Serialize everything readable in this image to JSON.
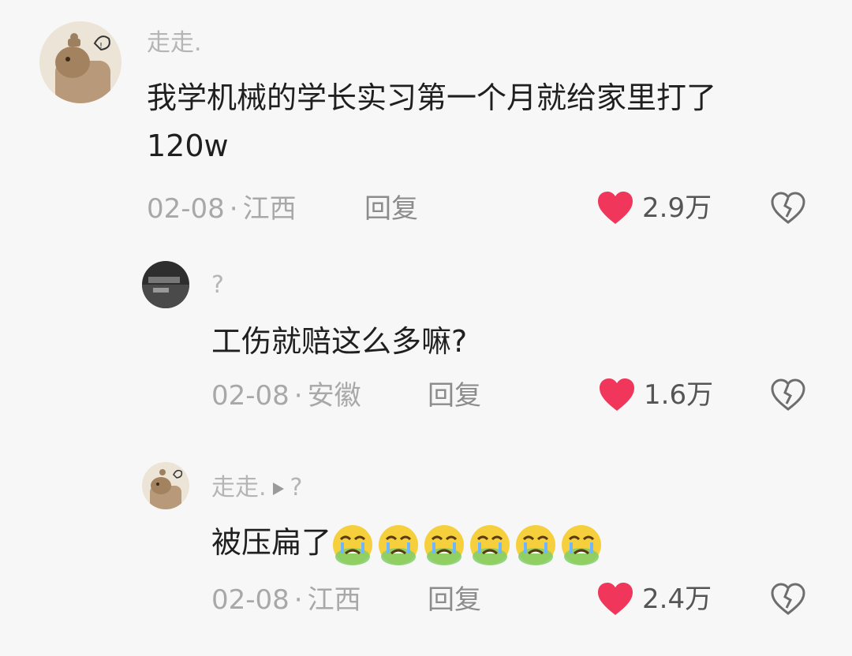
{
  "comments": [
    {
      "username": "走走.",
      "content_line1": "我学机械的学长实习第一个月就给家里打了",
      "content_line2": "120w",
      "date": "02-08",
      "separator": "·",
      "location": "江西",
      "reply_label": "回复",
      "likes": "2.9万",
      "avatar_icon": "capybara-avatar",
      "like_color": "#f0365a"
    },
    {
      "username": "?",
      "content": "工伤就赔这么多嘛?",
      "date": "02-08",
      "separator": "·",
      "location": "安徽",
      "reply_label": "回复",
      "likes": "1.6万",
      "avatar_icon": "dark-photo-avatar"
    },
    {
      "username": "走走.",
      "reply_to": "?",
      "content": "被压扁了",
      "emoji_count": 6,
      "emoji_name": "crying-face-emoji",
      "date": "02-08",
      "separator": "·",
      "location": "江西",
      "reply_label": "回复",
      "likes": "2.4万",
      "avatar_icon": "capybara-avatar"
    }
  ]
}
